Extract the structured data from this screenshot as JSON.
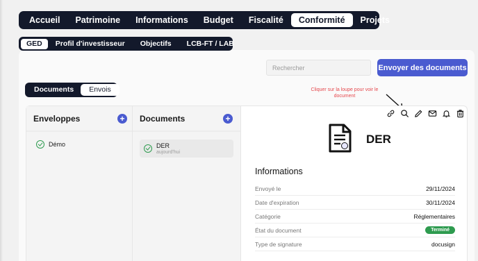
{
  "top_nav": [
    "Accueil",
    "Patrimoine",
    "Informations",
    "Budget",
    "Fiscalité",
    "Conformité",
    "Projets"
  ],
  "sub_nav": [
    "GED",
    "Profil d'investisseur",
    "Objectifs",
    "LCB-FT / LAB"
  ],
  "search": {
    "placeholder": "Rechercher"
  },
  "send_button": "Envoyer des documents",
  "toggle": {
    "documents": "Documents",
    "envois": "Envois"
  },
  "hint": "Cliquer sur la loupe pour voir le document",
  "envelopes": {
    "title": "Enveloppes",
    "items": [
      "Démo"
    ]
  },
  "documents": {
    "title": "Documents",
    "items": [
      {
        "name": "DER",
        "date": "aujourd'hui"
      }
    ]
  },
  "detail": {
    "doc_name": "DER",
    "icons": [
      "link-icon",
      "search-icon",
      "pencil-icon",
      "mail-icon",
      "bell-icon",
      "trash-icon"
    ],
    "info_title": "Informations",
    "rows": [
      {
        "label": "Envoyé le",
        "value": "29/11/2024"
      },
      {
        "label": "Date d'expiration",
        "value": "30/11/2024"
      },
      {
        "label": "Catégorie",
        "value": "Réglementaires"
      },
      {
        "label": "État du document",
        "value": "Terminé"
      },
      {
        "label": "Type de signature",
        "value": "docusign"
      }
    ]
  },
  "colors": {
    "accent": "#4a5bd0",
    "nav": "#13192b",
    "success": "#2e9b4f",
    "hint": "#e5484d"
  }
}
